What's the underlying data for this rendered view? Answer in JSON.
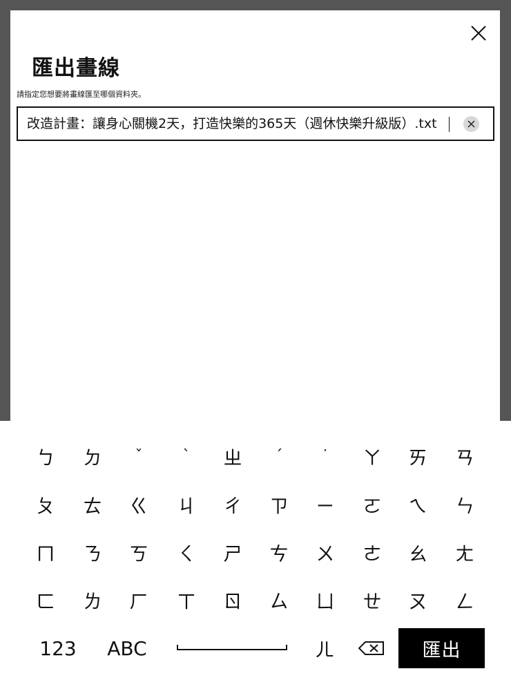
{
  "dialog": {
    "title": "匯出畫線",
    "subtitle": "請指定您想要將畫線匯至哪個資料夾。",
    "filename_value": "改造計畫：讓身心關機2天，打造快樂的365天（週休快樂升級版）.txt",
    "close_icon": "close-icon",
    "clear_icon": "clear-icon"
  },
  "keyboard": {
    "rows": [
      [
        "ㄅ",
        "ㄉ",
        "ˇ",
        "ˋ",
        "ㄓ",
        "ˊ",
        "˙",
        "ㄚ",
        "ㄞ",
        "ㄢ"
      ],
      [
        "ㄆ",
        "ㄊ",
        "ㄍ",
        "ㄐ",
        "ㄔ",
        "ㄗ",
        "ㄧ",
        "ㄛ",
        "ㄟ",
        "ㄣ"
      ],
      [
        "ㄇ",
        "ㄋ",
        "ㄎ",
        "ㄑ",
        "ㄕ",
        "ㄘ",
        "ㄨ",
        "ㄜ",
        "ㄠ",
        "ㄤ"
      ],
      [
        "ㄈ",
        "ㄌ",
        "ㄏ",
        "ㄒ",
        "ㄖ",
        "ㄙ",
        "ㄩ",
        "ㄝ",
        "ㄡ",
        "ㄥ"
      ]
    ],
    "numbers_label": "123",
    "abc_label": "ABC",
    "er_label": "ㄦ",
    "export_label": "匯出",
    "backspace_icon": "backspace-icon"
  }
}
